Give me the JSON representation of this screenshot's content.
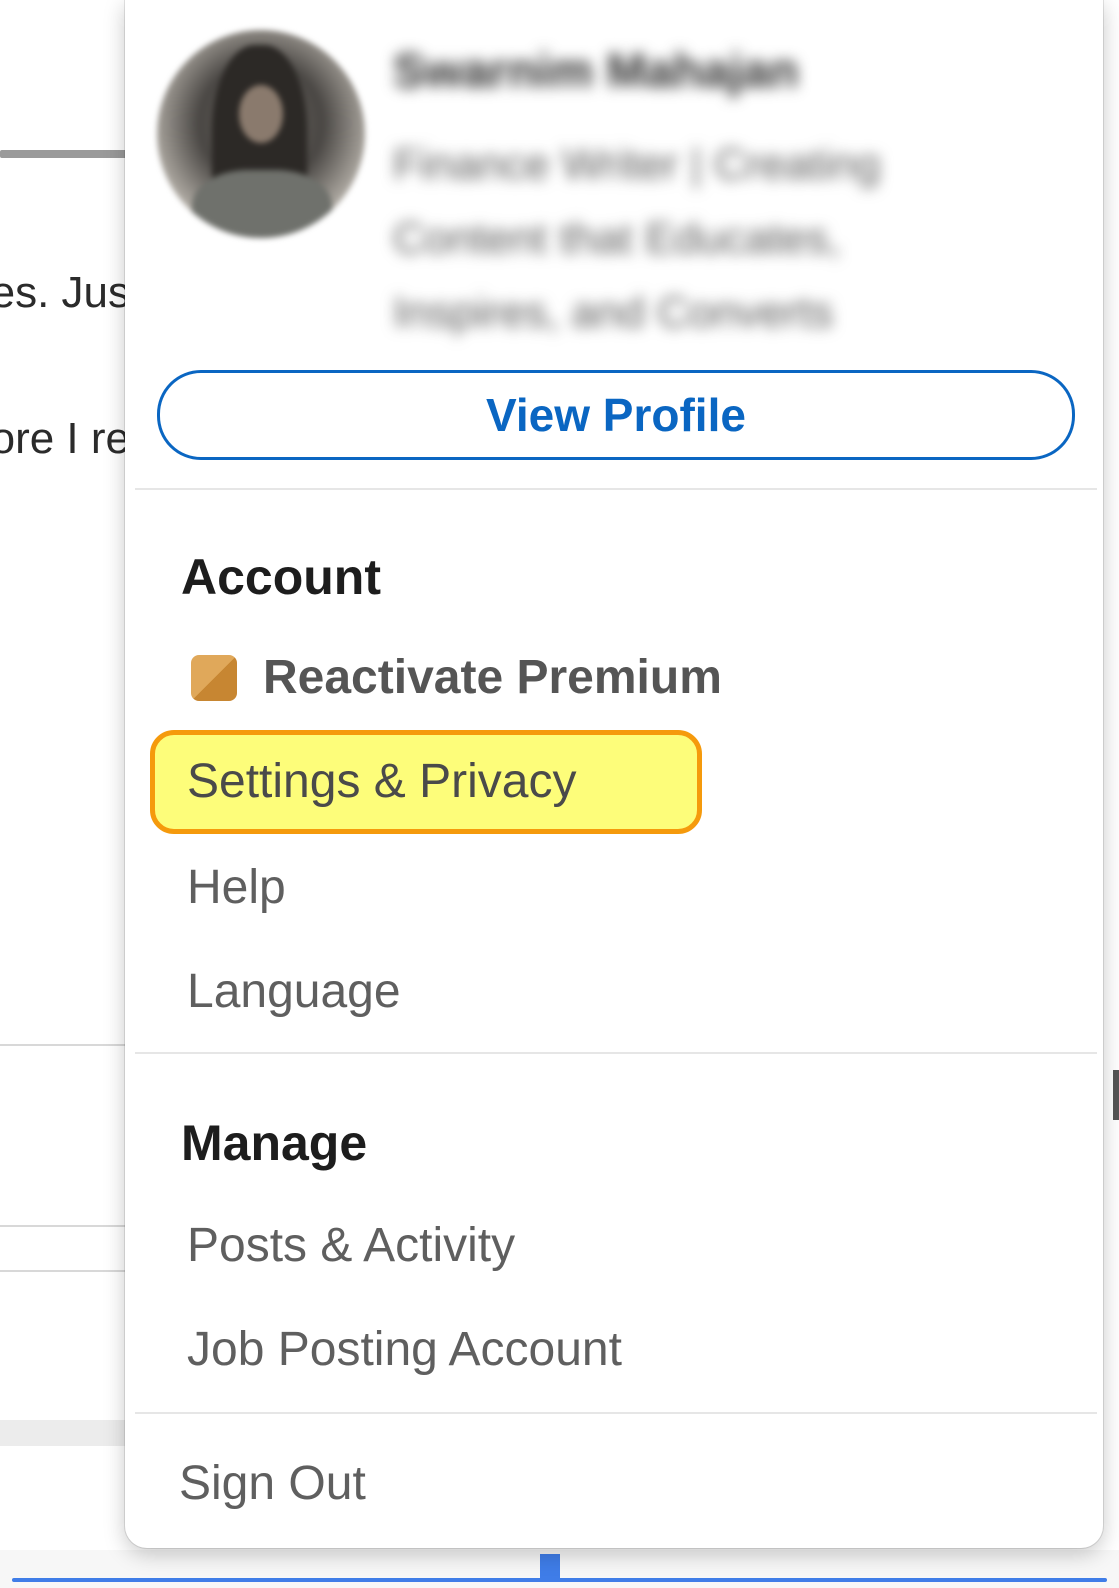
{
  "background": {
    "snippet_line_1": "es. Jus",
    "snippet_line_2": "ore I re"
  },
  "profile": {
    "name": "Swarnim Mahajan",
    "headline": "Finance Writer | Creating Content that Educates, Inspires, and Converts",
    "view_profile_label": "View Profile"
  },
  "account": {
    "title": "Account",
    "premium_label": "Reactivate Premium",
    "premium_icon": "premium-badge-icon",
    "items": [
      {
        "label": "Settings & Privacy",
        "highlighted": true
      },
      {
        "label": "Help"
      },
      {
        "label": "Language"
      }
    ]
  },
  "manage": {
    "title": "Manage",
    "items": [
      {
        "label": "Posts & Activity"
      },
      {
        "label": "Job Posting Account"
      }
    ]
  },
  "sign_out_label": "Sign Out",
  "colors": {
    "accent": "#0a66c2",
    "highlight_fill": "#fdfd7a",
    "highlight_border": "#f59a0c",
    "premium_gold": "#c78632"
  }
}
